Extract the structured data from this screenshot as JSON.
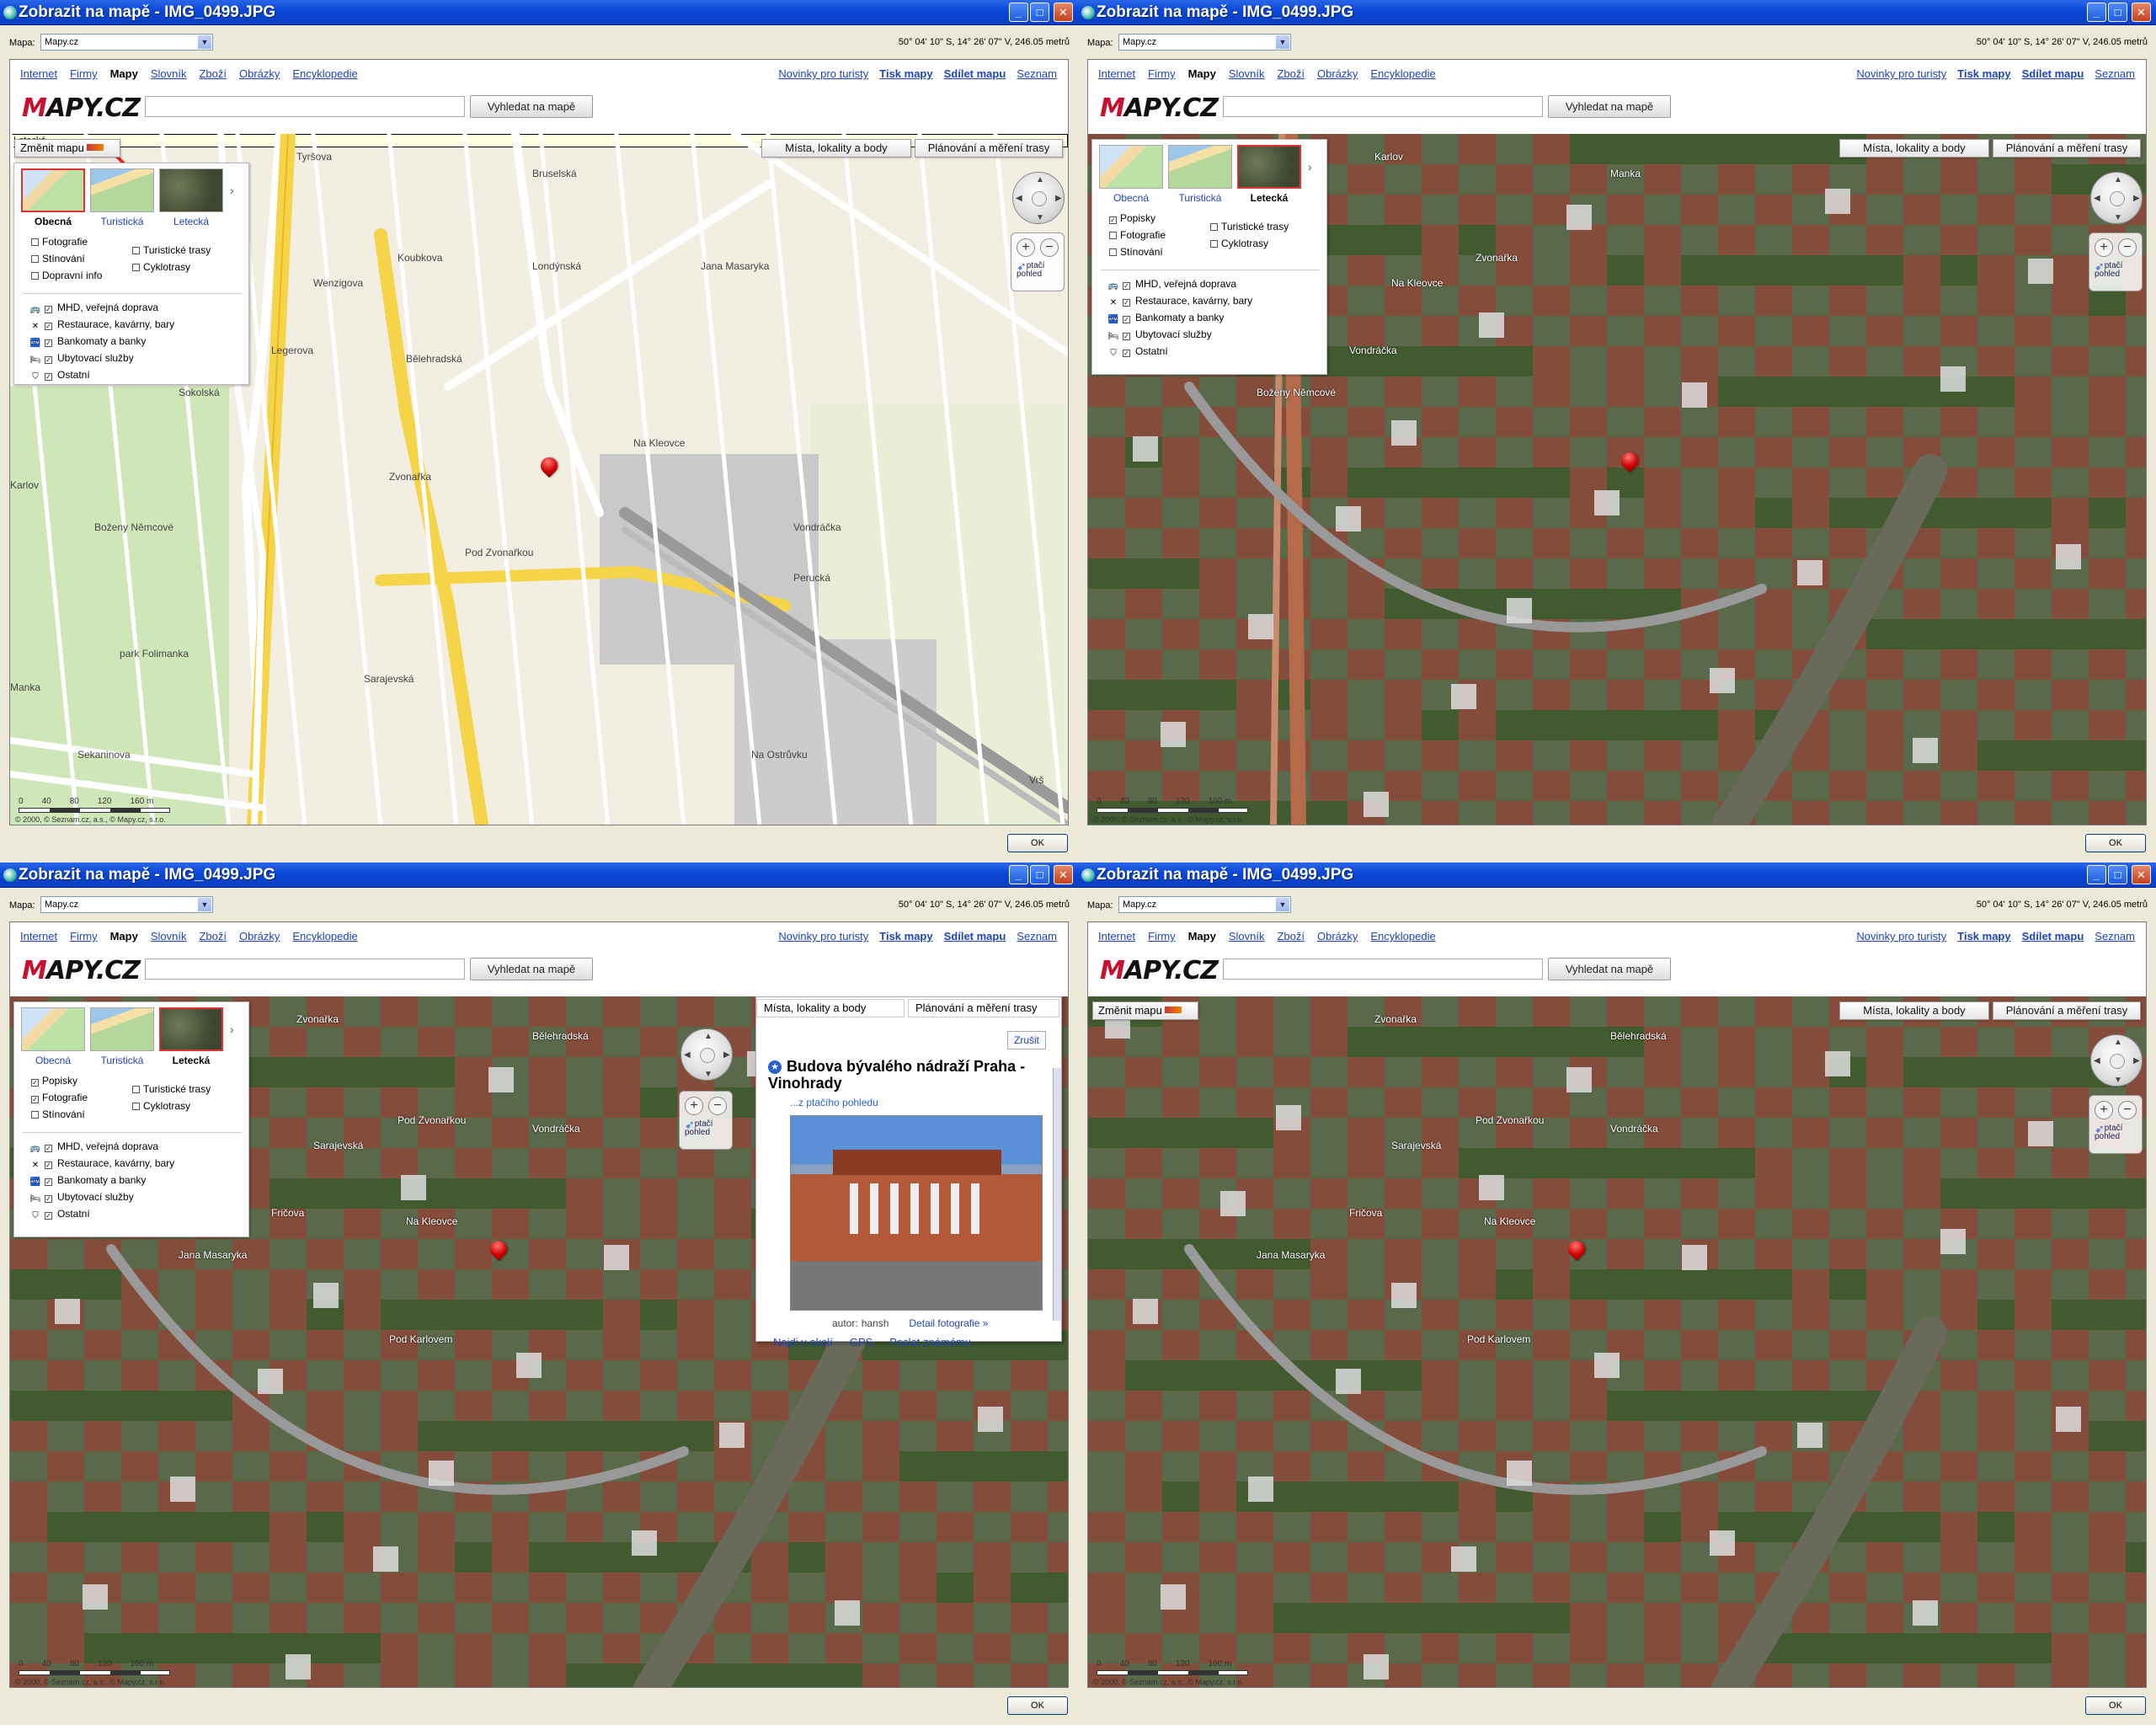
{
  "window": {
    "title": "Zobrazit na mapě - IMG_0499.JPG",
    "mapa_label": "Mapa:",
    "mapa_value": "Mapy.cz",
    "coords": "50° 04' 10\" S, 14° 26' 07\" V, 246.05 metrů",
    "ok_label": "OK"
  },
  "nav": {
    "links": [
      "Internet",
      "Firmy",
      "Mapy",
      "Slovník",
      "Zboží",
      "Obrázky",
      "Encyklopedie"
    ],
    "active": "Mapy",
    "right_links": [
      "Novinky pro turisty",
      "Tisk mapy",
      "Sdílet mapu",
      "Seznam"
    ]
  },
  "logo": {
    "m": "M",
    "rest": "APY.CZ"
  },
  "search": {
    "button": "Vyhledat na mapě"
  },
  "map_controls": {
    "change_map": "Změnit mapu",
    "places_button": "Místa, lokality a body",
    "route_button": "Plánování a měření trasy",
    "bird_view": "ptačí pohled",
    "zoom_in": "+",
    "zoom_out": "−"
  },
  "layer_panel": {
    "types": [
      "Obecná",
      "Turistická",
      "Letecká"
    ],
    "tooltip": "Letecká",
    "street_checks": [
      "Fotografie",
      "Stínování",
      "Dopravní info"
    ],
    "street_right_checks": [
      "Turistické trasy",
      "Cyklotrasy"
    ],
    "aerial_checks": [
      "Popisky",
      "Fotografie",
      "Stínování"
    ],
    "poi": [
      "MHD, veřejná doprava",
      "Restaurace, kavárny, bary",
      "Bankomaty a banky",
      "Ubytovací služby",
      "Ostatní"
    ]
  },
  "map_labels": {
    "street": [
      "Tyršova",
      "Bruselská",
      "Koubkova",
      "Wenzigova",
      "Legerova",
      "Sokolská",
      "Bělehradská",
      "Londýnská",
      "Zvonařka",
      "Na Kleovce",
      "Vondráčka",
      "Perucká",
      "Sarajevská",
      "Sekaninova",
      "Manka",
      "Karlov",
      "Boženy Němcové",
      "park Folimanka",
      "Pod Zvonařkou",
      "Jana Masaryka",
      "Na Ostrůvku",
      "Vrš"
    ],
    "aerial": [
      "Karlov",
      "Manka",
      "Zvonařka",
      "Na Kleovce",
      "Vondráčka",
      "Boženy Němcové"
    ],
    "aerial_zoom": [
      "Zvonařka",
      "Bělehradská",
      "Pod Zvonařkou",
      "Sarajevská",
      "Fričova",
      "Jana Masaryka",
      "Na Kleovce",
      "Vondráčka",
      "Pod Karlovem"
    ]
  },
  "scale": {
    "ticks": [
      "0",
      "40",
      "80",
      "120",
      "160 m"
    ]
  },
  "copyright": "© 2000, © Seznam.cz, a.s., © Mapy.cz, s.r.o.",
  "popup": {
    "tab1": "Místa, lokality a body",
    "tab2": "Plánování a měření trasy",
    "cancel": "Zrušit",
    "title": "Budova bývalého nádraží Praha - Vinohrady",
    "bird": "...z ptačího pohledu",
    "author_label": "autor:",
    "author": "hansh",
    "detail": "Detail fotografie »",
    "actions": [
      "Najdi v okolí",
      "GPS",
      "Poslat známému"
    ]
  }
}
